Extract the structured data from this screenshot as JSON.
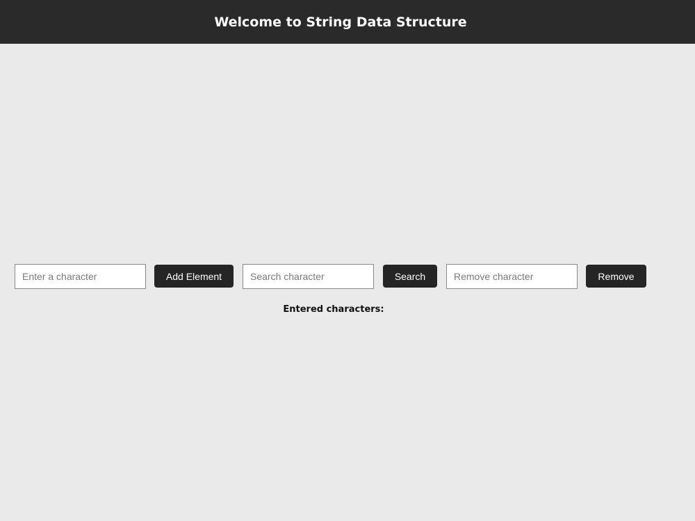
{
  "header": {
    "title": "Welcome to String Data Structure",
    "background": "#2a2a2a"
  },
  "controls": {
    "add_input_placeholder": "Enter a character",
    "add_button_label": "Add Element",
    "search_input_placeholder": "Search character",
    "search_button_label": "Search",
    "remove_input_placeholder": "Remove character",
    "remove_button_label": "Remove",
    "button_color": "#252525"
  },
  "output": {
    "label": "Entered characters:"
  },
  "page": {
    "background": "#eaeaea"
  }
}
